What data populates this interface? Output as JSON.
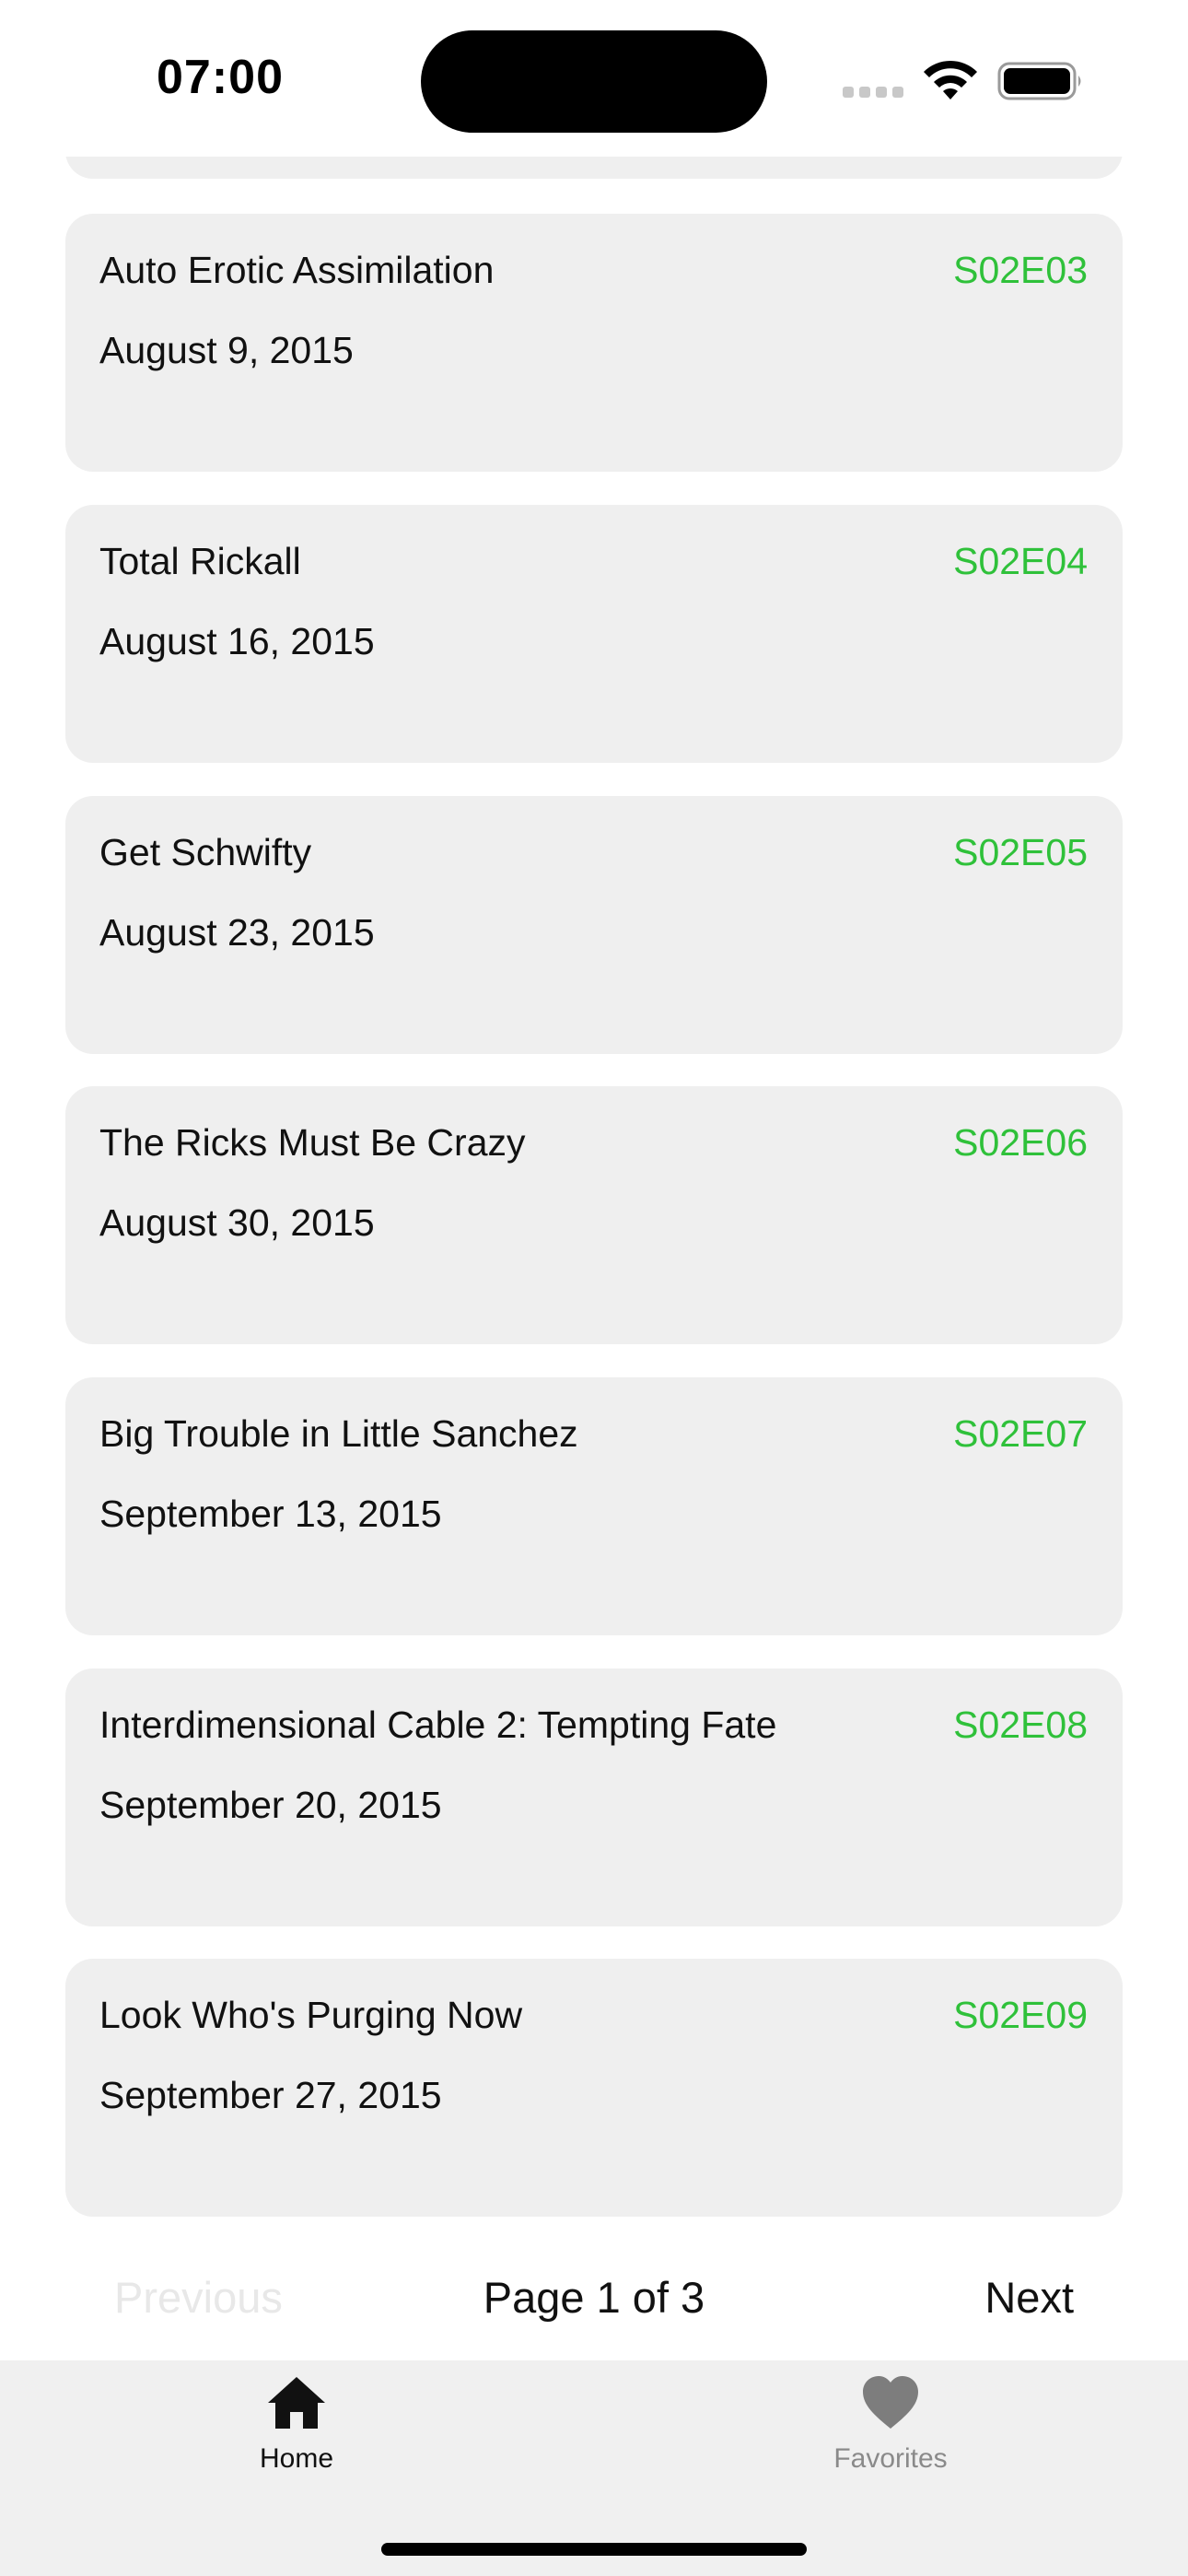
{
  "status_bar": {
    "time": "07:00"
  },
  "episodes": [
    {
      "title": "Auto Erotic Assimilation",
      "date": "August 9, 2015",
      "code": "S02E03"
    },
    {
      "title": "Total Rickall",
      "date": "August 16, 2015",
      "code": "S02E04"
    },
    {
      "title": "Get Schwifty",
      "date": "August 23, 2015",
      "code": "S02E05"
    },
    {
      "title": "The Ricks Must Be Crazy",
      "date": "August 30, 2015",
      "code": "S02E06"
    },
    {
      "title": "Big Trouble in Little Sanchez",
      "date": "September 13, 2015",
      "code": "S02E07"
    },
    {
      "title": "Interdimensional Cable 2: Tempting Fate",
      "date": "September 20, 2015",
      "code": "S02E08"
    },
    {
      "title": "Look Who's Purging Now",
      "date": "September 27, 2015",
      "code": "S02E09"
    }
  ],
  "pagination": {
    "previous_label": "Previous",
    "page_label": "Page 1 of 3",
    "next_label": "Next"
  },
  "tab_bar": {
    "home": {
      "label": "Home",
      "icon": "house-icon",
      "selected": true
    },
    "favorites": {
      "label": "Favorites",
      "icon": "heart-icon",
      "selected": false
    }
  },
  "colors": {
    "episode_code": "#2fc13a",
    "card_background": "#efefef",
    "tab_bar_background": "#f0f0f0",
    "disabled_text": "#e8e8e8"
  }
}
